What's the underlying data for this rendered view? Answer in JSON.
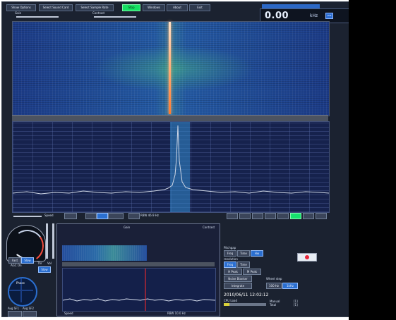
{
  "window": {
    "title": "",
    "bg": "#1b2230"
  },
  "top_menu": [
    {
      "label": "Show Options"
    },
    {
      "label": "Select Sound Card"
    },
    {
      "label": "Select Sample Rate"
    },
    {
      "label": "Stop",
      "active": true
    },
    {
      "label": "Windows"
    },
    {
      "label": "About"
    },
    {
      "label": "Exit"
    }
  ],
  "gain_label": "Gain",
  "contrast_label": "Contrast",
  "frequency": {
    "title": "",
    "value": "0.00",
    "unit": "kHz",
    "mini": "kHz"
  },
  "waterfall": {
    "center_line_color": "#ff7a2f"
  },
  "spectrum": {
    "band_color": "#348dd2"
  },
  "controls": {
    "speed_label": "Speed",
    "rbw_text": "RBW 46.9 Hz",
    "btn1": "",
    "btn2": "",
    "btn3": "",
    "btn4": "",
    "btn5": ""
  },
  "bottom": {
    "gain_label": "Gain",
    "contrast_label": "Contrast",
    "thr_label": "Thr",
    "vol_label": "Vol",
    "agc_on": "AGC On",
    "fast": "Fast",
    "slow": "Slow",
    "avg_sf1": "Avg SF1",
    "avg_sf2": "Avg SF2",
    "phase": "Phase",
    "speed_label": "Speed",
    "rbw_text": "RBW 10.0 Hz",
    "pitchgap_label": "Pitchgap",
    "freq_btn": "Freq",
    "time_btn": "Time",
    "hw_btn": "Hw",
    "resolution_label": "resolution",
    "res_buttons": [
      "Freq",
      "Time",
      "H Peak",
      "M Peak",
      "Noise Blanker",
      "Integrate"
    ],
    "wheel_step_label": "Wheel step",
    "wheel_btns": [
      "100 Hz",
      "1kHz"
    ],
    "timestamp": "2010/06/11 12:02:12",
    "cpu_label": "CPU Load",
    "manual_text": "Manual",
    "total_text": "Total",
    "manual_value": "[1]",
    "total_value": "[1]"
  }
}
